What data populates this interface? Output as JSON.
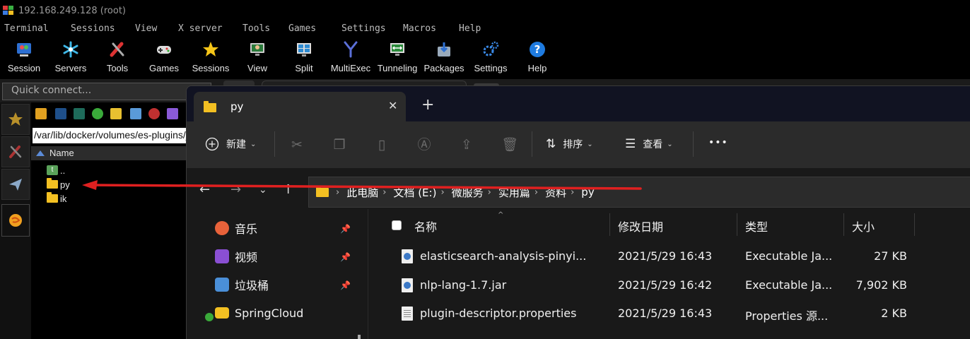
{
  "moba": {
    "window_title": "192.168.249.128 (root)",
    "menu": [
      "Terminal",
      "Sessions",
      "View",
      "X server",
      "Tools",
      "Games",
      "Settings",
      "Macros",
      "Help"
    ],
    "toolbar": [
      {
        "label": "Session",
        "icon": "session-icon"
      },
      {
        "label": "Servers",
        "icon": "servers-icon"
      },
      {
        "label": "Tools",
        "icon": "tools-icon"
      },
      {
        "label": "Games",
        "icon": "gamepad-icon"
      },
      {
        "label": "Sessions",
        "icon": "star-icon"
      },
      {
        "label": "View",
        "icon": "monitor-icon"
      },
      {
        "label": "Split",
        "icon": "split-icon"
      },
      {
        "label": "MultiExec",
        "icon": "multiexec-icon"
      },
      {
        "label": "Tunneling",
        "icon": "tunneling-icon"
      },
      {
        "label": "Packages",
        "icon": "packages-icon"
      },
      {
        "label": "Settings",
        "icon": "gears-icon"
      },
      {
        "label": "Help",
        "icon": "help-icon"
      }
    ],
    "quick_connect_placeholder": "Quick connect...",
    "sftp": {
      "path": "/var/lib/docker/volumes/es-plugins/_data",
      "column": "Name",
      "rows": [
        "..",
        "py",
        "ik"
      ]
    }
  },
  "explorer": {
    "tab_title": "py",
    "commands": {
      "new": "新建",
      "sort": "排序",
      "view": "查看",
      "more": "•••"
    },
    "breadcrumbs": [
      "此电脑",
      "文档 (E:)",
      "微服务",
      "实用篇",
      "资料",
      "py"
    ],
    "nav": [
      {
        "label": "音乐",
        "color": "#e8623a"
      },
      {
        "label": "视频",
        "color": "#8a4fd3"
      },
      {
        "label": "垃圾桶",
        "color": "#4a8fd8"
      },
      {
        "label": "SpringCloud",
        "color": "#f3c022"
      }
    ],
    "columns": {
      "name": "名称",
      "date": "修改日期",
      "type": "类型",
      "size": "大小"
    },
    "files": [
      {
        "name": "elasticsearch-analysis-pinyi...",
        "date": "2021/5/29 16:43",
        "type": "Executable Ja...",
        "size": "27 KB",
        "kind": "jar"
      },
      {
        "name": "nlp-lang-1.7.jar",
        "date": "2021/5/29 16:42",
        "type": "Executable Ja...",
        "size": "7,902 KB",
        "kind": "jar"
      },
      {
        "name": "plugin-descriptor.properties",
        "date": "2021/5/29 16:43",
        "type": "Properties 源...",
        "size": "2 KB",
        "kind": "prop"
      }
    ]
  },
  "colors": {
    "annotation_arrow": "#e02020",
    "folder": "#f3c022",
    "moba_bg": "#000000",
    "explorer_bg": "#191919"
  }
}
